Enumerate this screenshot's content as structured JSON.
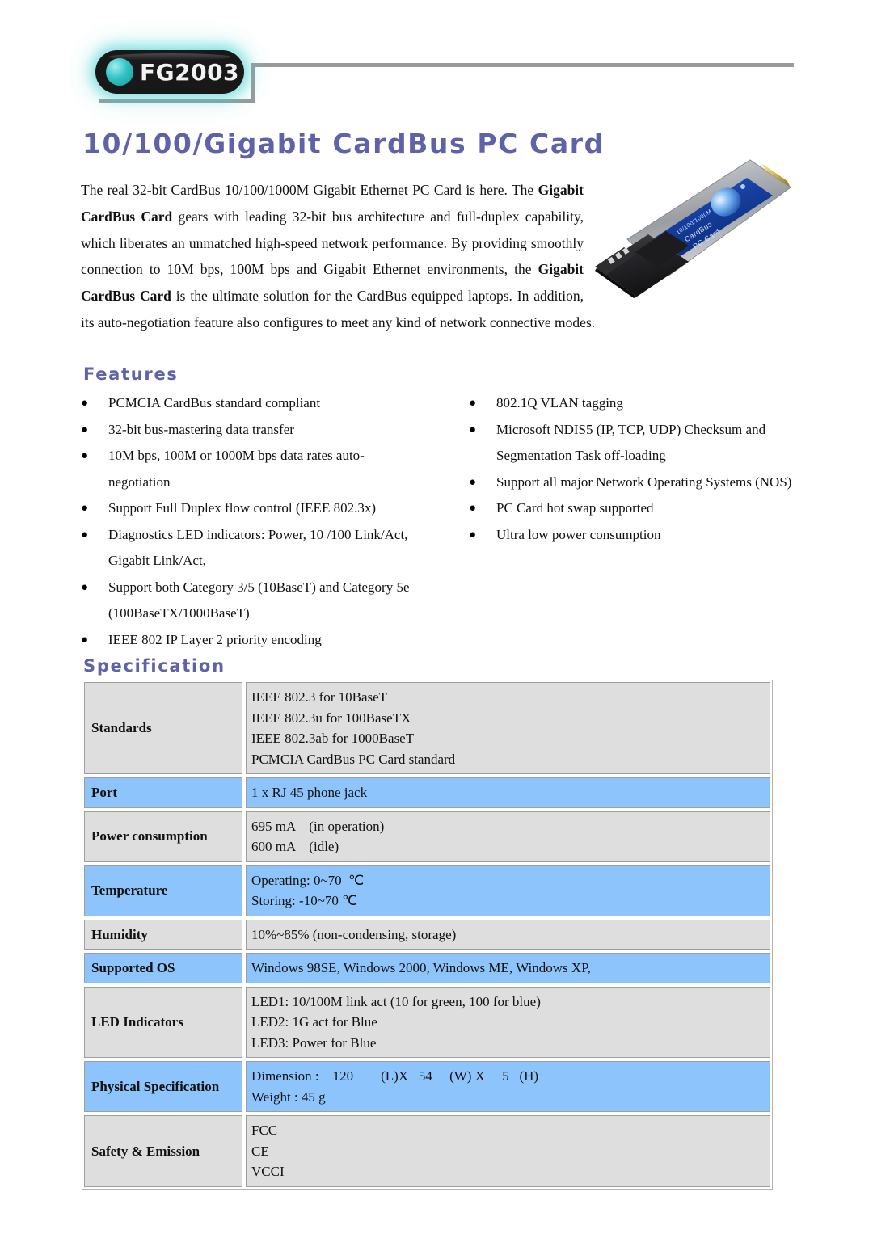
{
  "header": {
    "logo_badge_label": "FG2003",
    "logo_dot_icon": "teal-dot-icon"
  },
  "title": "10/100/Gigabit CardBus PC Card",
  "product_image": {
    "icon": "pcmcia-cardbus-card-photo",
    "label_line1": "10/100/1000M",
    "label_line2": "CardBus",
    "label_line3": "PC Card"
  },
  "intro": {
    "part1": "The real 32-bit CardBus 10/100/1000M Gigabit Ethernet PC Card is here.   The ",
    "bold1": "Gigabit CardBus Card",
    "part2": " gears with leading 32-bit bus architecture and full-duplex capability, which liberates an unmatched high-speed network performance. By providing smoothly connection to 10M bps, 100M bps and Gigabit Ethernet environments, the ",
    "bold2": "Gigabit CardBus Card",
    "part3": " is the ultimate solution for the CardBus equipped laptops. In addition, its auto-negotiation feature also configures to meet any kind of network connective modes."
  },
  "features": {
    "heading": "Features",
    "bullet_glyph": "●",
    "left_column": [
      "PCMCIA CardBus standard compliant",
      "32-bit bus-mastering data transfer",
      "10M bps, 100M or 1000M bps data rates auto-negotiation",
      "Support Full Duplex flow control (IEEE 802.3x)",
      "Diagnostics LED indicators: Power, 10 /100 Link/Act, Gigabit Link/Act,",
      "Support both Category 3/5 (10BaseT) and Category 5e (100BaseTX/1000BaseT)",
      "IEEE 802 IP Layer 2 priority encoding"
    ],
    "right_column": [
      "802.1Q VLAN tagging",
      "Microsoft NDIS5 (IP, TCP, UDP) Checksum and Segmentation Task off-loading",
      "Support all major Network Operating Systems (NOS)",
      "PC Card hot swap supported",
      "Ultra low power consumption"
    ]
  },
  "specification": {
    "heading": "Specification",
    "rows": [
      {
        "label": "Standards",
        "value_lines": [
          "IEEE 802.3 for 10BaseT",
          "IEEE 802.3u for 100BaseTX",
          "IEEE 802.3ab for 1000BaseT",
          "PCMCIA CardBus PC Card standard"
        ],
        "style": "gray"
      },
      {
        "label": "Port",
        "value_lines": [
          "1 x RJ 45 phone jack"
        ],
        "style": "blue"
      },
      {
        "label": "Power consumption",
        "value_lines": [
          "695 mA    (in operation)",
          "600 mA    (idle)"
        ],
        "style": "gray"
      },
      {
        "label": "Temperature",
        "value_lines": [
          "Operating: 0~70  ℃",
          "Storing: -10~70 ℃"
        ],
        "style": "blue"
      },
      {
        "label": "Humidity",
        "value_lines": [
          "10%~85% (non-condensing, storage)"
        ],
        "style": "gray"
      },
      {
        "label": "Supported OS",
        "value_lines": [
          "Windows 98SE, Windows 2000, Windows ME, Windows XP,"
        ],
        "style": "blue"
      },
      {
        "label": "LED Indicators",
        "value_lines": [
          "LED1: 10/100M link act (10 for green, 100 for blue)",
          "LED2: 1G act for Blue",
          "LED3: Power for Blue"
        ],
        "style": "gray"
      },
      {
        "label": "Physical Specification",
        "value_lines": [
          "Dimension :    120        (L)X   54     (W) X     5   (H)",
          "Weight : 45 g"
        ],
        "style": "blue"
      },
      {
        "label": "Safety & Emission",
        "value_lines": [
          "FCC",
          "CE",
          "VCCI"
        ],
        "style": "gray"
      }
    ]
  },
  "colors": {
    "heading_purple": "#5f62a8",
    "row_gray": "#dedede",
    "row_blue": "#8dc4fb",
    "rule_gray": "#9a9a9a",
    "badge_black": "#181818",
    "badge_glow_teal": "#46d2d2"
  }
}
